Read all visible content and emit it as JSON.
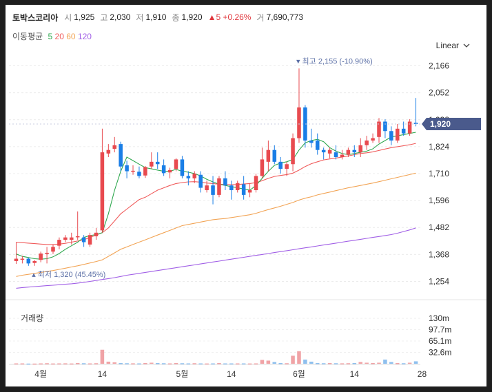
{
  "header": {
    "name": "토박스코리아",
    "open_label": "시",
    "open": "1,925",
    "high_label": "고",
    "high": "2,030",
    "low_label": "저",
    "low": "1,910",
    "close_label": "종",
    "close": "1,920",
    "change": "▲5 +0.26%",
    "volume_label": "거",
    "volume": "7,690,773"
  },
  "ma": {
    "label": "이동평균",
    "items": [
      {
        "period": "5",
        "color": "#2fa84f"
      },
      {
        "period": "20",
        "color": "#f05a5a"
      },
      {
        "period": "60",
        "color": "#f2a455"
      },
      {
        "period": "120",
        "color": "#a05ee6"
      }
    ]
  },
  "scale_button": "Linear",
  "volume_panel_label": "거래량",
  "colors": {
    "up": "#e84a4f",
    "down": "#1a7ee6",
    "vol_up": "#f0a3a6",
    "vol_down": "#8fc0ee",
    "ma5": "#2fa84f",
    "ma20": "#f05a5a",
    "ma60": "#f2a455",
    "ma120": "#a05ee6",
    "current_tag": "#4a5a8c",
    "annotation": "#5b6fa6"
  },
  "chart_data": {
    "type": "candlestick",
    "y_ticks": [
      "2,166",
      "2,052",
      "1,938",
      "1,824",
      "1,710",
      "1,596",
      "1,482",
      "1,368",
      "1,254"
    ],
    "y_tick_values": [
      2166,
      2052,
      1938,
      1824,
      1710,
      1596,
      1482,
      1368,
      1254
    ],
    "ylim": [
      1200,
      2220
    ],
    "x_ticks": [
      "4월",
      "14",
      "5월",
      "14",
      "6월",
      "14",
      "28"
    ],
    "x_tick_index": [
      4,
      14,
      27,
      35,
      46,
      55,
      66
    ],
    "volume_ticks": [
      "130m",
      "97.7m",
      "65.1m",
      "32.6m"
    ],
    "volume_tick_values": [
      130,
      97.7,
      65.1,
      32.6
    ],
    "volume_ylim": [
      0,
      140
    ],
    "current_price": "1,920",
    "current_price_value": 1920,
    "annotations": {
      "max": {
        "text": "최고 2,155 (-10.90%)",
        "index": 46,
        "value": 2155
      },
      "min": {
        "text": "최저 1,320 (45.45%)",
        "index": 3,
        "value": 1320
      }
    },
    "candles": [
      [
        1340,
        1420,
        1328,
        1350
      ],
      [
        1348,
        1362,
        1330,
        1350
      ],
      [
        1350,
        1355,
        1320,
        1330
      ],
      [
        1332,
        1345,
        1320,
        1340
      ],
      [
        1345,
        1380,
        1335,
        1372
      ],
      [
        1370,
        1400,
        1330,
        1375
      ],
      [
        1380,
        1410,
        1370,
        1400
      ],
      [
        1405,
        1440,
        1390,
        1430
      ],
      [
        1430,
        1450,
        1420,
        1440
      ],
      [
        1430,
        1460,
        1410,
        1440
      ],
      [
        1445,
        1550,
        1430,
        1445
      ],
      [
        1440,
        1450,
        1400,
        1420
      ],
      [
        1410,
        1460,
        1400,
        1450
      ],
      [
        1445,
        1480,
        1430,
        1460
      ],
      [
        1470,
        1900,
        1460,
        1800
      ],
      [
        1795,
        1835,
        1780,
        1810
      ],
      [
        1815,
        1865,
        1800,
        1830
      ],
      [
        1835,
        1845,
        1720,
        1740
      ],
      [
        1745,
        1765,
        1690,
        1720
      ],
      [
        1720,
        1745,
        1705,
        1722
      ],
      [
        1718,
        1740,
        1690,
        1700
      ],
      [
        1702,
        1742,
        1692,
        1738
      ],
      [
        1740,
        1800,
        1730,
        1760
      ],
      [
        1760,
        1800,
        1730,
        1750
      ],
      [
        1745,
        1770,
        1700,
        1712
      ],
      [
        1715,
        1735,
        1690,
        1725
      ],
      [
        1730,
        1775,
        1720,
        1770
      ],
      [
        1770,
        1785,
        1690,
        1700
      ],
      [
        1700,
        1720,
        1660,
        1690
      ],
      [
        1690,
        1720,
        1670,
        1710
      ],
      [
        1705,
        1720,
        1630,
        1650
      ],
      [
        1640,
        1680,
        1630,
        1660
      ],
      [
        1660,
        1700,
        1580,
        1620
      ],
      [
        1620,
        1700,
        1610,
        1690
      ],
      [
        1690,
        1720,
        1640,
        1660
      ],
      [
        1660,
        1680,
        1600,
        1640
      ],
      [
        1640,
        1680,
        1630,
        1670
      ],
      [
        1665,
        1700,
        1600,
        1620
      ],
      [
        1630,
        1670,
        1610,
        1640
      ],
      [
        1640,
        1710,
        1630,
        1700
      ],
      [
        1700,
        1820,
        1690,
        1770
      ],
      [
        1760,
        1850,
        1720,
        1810
      ],
      [
        1810,
        1830,
        1750,
        1760
      ],
      [
        1760,
        1780,
        1710,
        1730
      ],
      [
        1730,
        1760,
        1700,
        1750
      ],
      [
        1750,
        1880,
        1720,
        1860
      ],
      [
        1860,
        2155,
        1840,
        1990
      ],
      [
        1990,
        2000,
        1820,
        1850
      ],
      [
        1850,
        1900,
        1820,
        1840
      ],
      [
        1850,
        1880,
        1790,
        1810
      ],
      [
        1810,
        1820,
        1770,
        1800
      ],
      [
        1795,
        1820,
        1775,
        1810
      ],
      [
        1800,
        1830,
        1770,
        1780
      ],
      [
        1780,
        1810,
        1770,
        1790
      ],
      [
        1790,
        1820,
        1780,
        1810
      ],
      [
        1810,
        1830,
        1780,
        1800
      ],
      [
        1800,
        1860,
        1780,
        1830
      ],
      [
        1830,
        1870,
        1810,
        1850
      ],
      [
        1850,
        1880,
        1840,
        1860
      ],
      [
        1865,
        1945,
        1840,
        1930
      ],
      [
        1930,
        1940,
        1860,
        1890
      ],
      [
        1890,
        1910,
        1830,
        1850
      ],
      [
        1850,
        1920,
        1840,
        1900
      ],
      [
        1900,
        1930,
        1870,
        1880
      ],
      [
        1880,
        1940,
        1870,
        1930
      ],
      [
        1925,
        2030,
        1910,
        1920
      ]
    ],
    "volume": [
      1,
      1,
      0.5,
      0.5,
      1,
      1.5,
      0.8,
      1,
      1.2,
      0.8,
      2,
      1.5,
      1,
      1.5,
      40,
      6,
      4,
      2,
      1.5,
      1.2,
      1,
      2,
      3,
      2,
      1.5,
      1,
      2,
      1.5,
      1,
      1.5,
      1,
      0.8,
      1,
      2,
      1,
      1,
      1,
      1,
      0.8,
      1,
      11,
      9,
      5,
      2,
      1.5,
      23,
      36,
      12,
      6,
      2,
      1.5,
      2,
      1.5,
      1.2,
      1.5,
      2,
      5,
      3,
      2,
      3,
      12,
      5,
      2,
      1.5,
      3,
      7
    ],
    "ma5": [
      1370,
      1360,
      1355,
      1350,
      1348,
      1350,
      1358,
      1372,
      1390,
      1405,
      1420,
      1440,
      1448,
      1452,
      1460,
      1540,
      1640,
      1720,
      1780,
      1765,
      1750,
      1735,
      1730,
      1725,
      1720,
      1720,
      1728,
      1720,
      1716,
      1710,
      1700,
      1686,
      1675,
      1665,
      1660,
      1655,
      1650,
      1645,
      1640,
      1660,
      1690,
      1720,
      1745,
      1755,
      1760,
      1770,
      1810,
      1840,
      1850,
      1855,
      1845,
      1820,
      1805,
      1795,
      1790,
      1795,
      1800,
      1805,
      1815,
      1835,
      1850,
      1865,
      1870,
      1875,
      1880,
      1885
    ],
    "ma20": [
      1420,
      1418,
      1416,
      1414,
      1412,
      1410,
      1410,
      1412,
      1415,
      1420,
      1425,
      1430,
      1440,
      1450,
      1460,
      1480,
      1510,
      1540,
      1560,
      1580,
      1600,
      1610,
      1625,
      1640,
      1650,
      1660,
      1668,
      1672,
      1675,
      1676,
      1674,
      1670,
      1668,
      1665,
      1664,
      1663,
      1664,
      1666,
      1668,
      1672,
      1680,
      1690,
      1698,
      1702,
      1706,
      1712,
      1725,
      1740,
      1752,
      1760,
      1768,
      1772,
      1776,
      1780,
      1785,
      1790,
      1795,
      1798,
      1802,
      1808,
      1814,
      1820,
      1824,
      1828,
      1832,
      1838
    ],
    "ma60": [
      1275,
      1280,
      1284,
      1288,
      1292,
      1296,
      1300,
      1305,
      1310,
      1315,
      1320,
      1326,
      1332,
      1338,
      1345,
      1360,
      1375,
      1390,
      1400,
      1410,
      1420,
      1430,
      1440,
      1450,
      1460,
      1470,
      1480,
      1490,
      1495,
      1500,
      1505,
      1510,
      1515,
      1518,
      1520,
      1524,
      1528,
      1532,
      1536,
      1542,
      1550,
      1558,
      1565,
      1572,
      1580,
      1588,
      1598,
      1606,
      1612,
      1620,
      1626,
      1632,
      1638,
      1644,
      1650,
      1655,
      1660,
      1665,
      1670,
      1676,
      1682,
      1688,
      1694,
      1700,
      1706,
      1712
    ],
    "ma120": [
      1225,
      1228,
      1230,
      1232,
      1234,
      1236,
      1238,
      1240,
      1242,
      1244,
      1247,
      1250,
      1254,
      1258,
      1262,
      1266,
      1270,
      1275,
      1280,
      1284,
      1288,
      1292,
      1296,
      1300,
      1304,
      1308,
      1312,
      1316,
      1320,
      1324,
      1328,
      1332,
      1336,
      1340,
      1344,
      1348,
      1352,
      1356,
      1360,
      1364,
      1368,
      1372,
      1376,
      1380,
      1384,
      1388,
      1392,
      1396,
      1400,
      1404,
      1408,
      1412,
      1416,
      1420,
      1424,
      1428,
      1432,
      1436,
      1440,
      1444,
      1448,
      1452,
      1458,
      1465,
      1472,
      1480
    ]
  }
}
